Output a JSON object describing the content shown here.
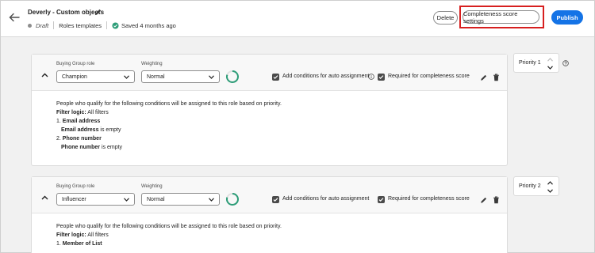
{
  "header": {
    "title": "Deverly - Custom objects",
    "status": "Draft",
    "breadcrumb": "Roles templates",
    "saved": "Saved 4 months ago",
    "delete_label": "Delete",
    "score_settings_label": "Completeness score settings",
    "publish_label": "Publish"
  },
  "colors": {
    "accent": "#1473e6",
    "highlight": "#d71f1f"
  },
  "cards": [
    {
      "role_label": "Buying Group role",
      "role_value": "Champion",
      "weighting_label": "Weighting",
      "weighting_value": "Normal",
      "auto_assign_label": "Add conditions for auto assignment",
      "required_label": "Required for completeness score",
      "description": "People who qualify for the following conditions will be assigned to this role based on priority.",
      "filter_logic_label": "Filter logic:",
      "filter_logic_value": "All filters",
      "conditions": [
        {
          "num": "1.",
          "field": "Email address",
          "field_repeat": "Email address",
          "op": "is empty"
        },
        {
          "num": "2.",
          "field": "Phone number",
          "field_repeat": "Phone number",
          "op": "is empty"
        }
      ],
      "priority_label": "Priority 1"
    },
    {
      "role_label": "Buying Group role",
      "role_value": "Influencer",
      "weighting_label": "Weighting",
      "weighting_value": "Normal",
      "auto_assign_label": "Add conditions for auto assignment",
      "required_label": "Required for completeness score",
      "description": "People who qualify for the following conditions will be assigned to this role based on priority.",
      "filter_logic_label": "Filter logic:",
      "filter_logic_value": "All filters",
      "conditions": [
        {
          "num": "1.",
          "field": "Member of List"
        }
      ],
      "priority_label": "Priority 2"
    }
  ]
}
